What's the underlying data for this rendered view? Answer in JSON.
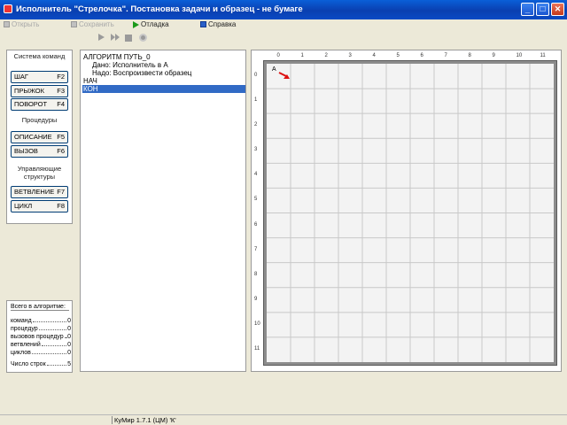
{
  "window": {
    "title": "Исполнитель \"Стрелочка\". Постановка задачи и образец - не бумаге",
    "minimize": "_",
    "maximize": "□",
    "close": "✕"
  },
  "menu": [
    {
      "label": "Открыть",
      "icon": "disk-icon",
      "disabled": true
    },
    {
      "label": "Сохранить",
      "icon": "disk-icon",
      "disabled": true
    },
    {
      "label": "Отладка",
      "icon": "play-icon",
      "disabled": false
    },
    {
      "label": "Справка",
      "icon": "help-icon",
      "disabled": false
    }
  ],
  "toolbar": [
    "run-icon",
    "step-icon",
    "stop-icon",
    "reset-icon"
  ],
  "left": {
    "system_title": "Система команд",
    "commands": [
      {
        "label": "ШАГ",
        "key": "F2"
      },
      {
        "label": "ПРЫЖОК",
        "key": "F3"
      },
      {
        "label": "ПОВОРОТ",
        "key": "F4"
      }
    ],
    "procedures_title": "Процедуры",
    "procedures": [
      {
        "label": "ОПИСАНИЕ",
        "key": "F5"
      },
      {
        "label": "ВЫЗОВ",
        "key": "F6"
      }
    ],
    "structures_title": "Управляющие структуры",
    "structures": [
      {
        "label": "ВЕТВЛЕНИЕ",
        "key": "F7"
      },
      {
        "label": "ЦИКЛ",
        "key": "F8"
      }
    ]
  },
  "stats": {
    "title": "Всего в алгоритме:",
    "rows": [
      {
        "label": "команд",
        "value": "0"
      },
      {
        "label": "процедур",
        "value": "0"
      },
      {
        "label": "вызовов процедур",
        "value": "0"
      },
      {
        "label": "ветвлений",
        "value": "0"
      },
      {
        "label": "циклов",
        "value": "0"
      },
      {
        "label": "Число строк",
        "value": "5"
      }
    ]
  },
  "code": {
    "lines": [
      "АЛГОРИТМ ПУТЬ_0",
      "  Дано: Исполнитель в А",
      "  Надо: Воспроизвести образец",
      "НАЧ",
      "КОН"
    ],
    "selected_index": 4
  },
  "grid": {
    "columns": 12,
    "rows": 12,
    "col_labels": [
      "0",
      "1",
      "2",
      "3",
      "4",
      "5",
      "6",
      "7",
      "8",
      "9",
      "10",
      "11"
    ],
    "row_labels": [
      "0",
      "1",
      "2",
      "3",
      "4",
      "5",
      "6",
      "7",
      "8",
      "9",
      "10",
      "11"
    ],
    "start_label": "А",
    "arrow_color": "#dd1111",
    "line_color": "#c8c8c8"
  },
  "status": {
    "text": "КуМир 1.7.1 (ЦМ) 'К'"
  }
}
